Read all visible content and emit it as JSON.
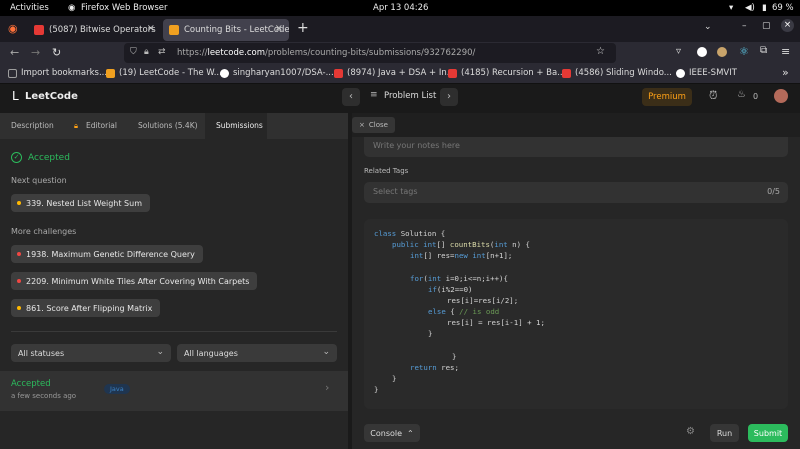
{
  "system_bar": {
    "activities": "Activities",
    "app_name": "Firefox Web Browser",
    "datetime": "Apr 13  04:26",
    "battery": "69 %"
  },
  "browser": {
    "tabs": [
      {
        "title": "(5087) Bitwise Operators",
        "favicon_color": "#e53935"
      },
      {
        "title": "Counting Bits - LeetCode",
        "favicon_color": "#f0a020"
      }
    ],
    "new_tab_label": "+",
    "url_prefix": "https://",
    "url_domain": "leetcode.com",
    "url_path": "/problems/counting-bits/submissions/932762290/",
    "bookmarks": [
      {
        "label": "Import bookmarks...",
        "color": "#9e9e9e"
      },
      {
        "label": "(19) LeetCode - The W...",
        "color": "#f0a020"
      },
      {
        "label": "singharyan1007/DSA-...",
        "color": "#ffffff"
      },
      {
        "label": "(8974) Java + DSA + In...",
        "color": "#e53935"
      },
      {
        "label": "(4185) Recursion + Ba...",
        "color": "#e53935"
      },
      {
        "label": "(4586) Sliding Windo...",
        "color": "#e53935"
      },
      {
        "label": "IEEE-SMVIT",
        "color": "#ffffff"
      }
    ]
  },
  "leetcode": {
    "logo": "LeetCode",
    "problem_list": "Problem List",
    "premium": "Premium",
    "streak": "0",
    "left_tabs": [
      "Description",
      "Editorial",
      "Solutions (5.4K)",
      "Submissions"
    ],
    "status": "Accepted",
    "next_question_heading": "Next question",
    "next_question": "339. Nested List Weight Sum",
    "more_challenges_heading": "More challenges",
    "challenges": [
      "1938. Maximum Genetic Difference Query",
      "2209. Minimum White Tiles After Covering With Carpets",
      "861. Score After Flipping Matrix"
    ],
    "filter_status": "All statuses",
    "filter_language": "All languages",
    "submission": {
      "status": "Accepted",
      "time": "a few seconds ago",
      "lang": "Java"
    },
    "close_label": "Close",
    "notes_placeholder": "Write your notes here",
    "related_tags_label": "Related Tags",
    "tags_placeholder": "Select tags",
    "tags_count": "0/5",
    "console_label": "Console",
    "run_label": "Run",
    "submit_label": "Submit",
    "colors": {
      "accent_green": "#2cbb5d",
      "premium": "#ffa116",
      "dot_yellow": "#ffb800",
      "dot_red": "#ef4743"
    }
  },
  "code_lines": [
    {
      "indent": 0,
      "html_key": "l0"
    },
    {
      "indent": 1,
      "html_key": "l1"
    }
  ],
  "code": {
    "l0a": "class",
    "l0b": " Solution {",
    "l1a": "public",
    "l1b": " int",
    "l1c": "[] ",
    "l1d": "countBits",
    "l1e": "(",
    "l1f": "int",
    "l1g": " n) {",
    "l2a": "int",
    "l2b": "[] res=",
    "l2c": "new",
    "l2d": " int",
    "l2e": "[n+1];",
    "l3a": "for",
    "l3b": "(",
    "l3c": "int",
    "l3d": " i=0;i<=n;i++){",
    "l4a": "if",
    "l4b": "(i%2==0)",
    "l5": "res[i]=res[i/2];",
    "l6a": "else",
    "l6b": " { ",
    "l6c": "// is odd",
    "l7": "res[i] = res[i-1] + 1;",
    "l8": "}",
    "l9": "}",
    "l10a": "return",
    "l10b": " res;",
    "l11": "}",
    "l12": "}"
  }
}
